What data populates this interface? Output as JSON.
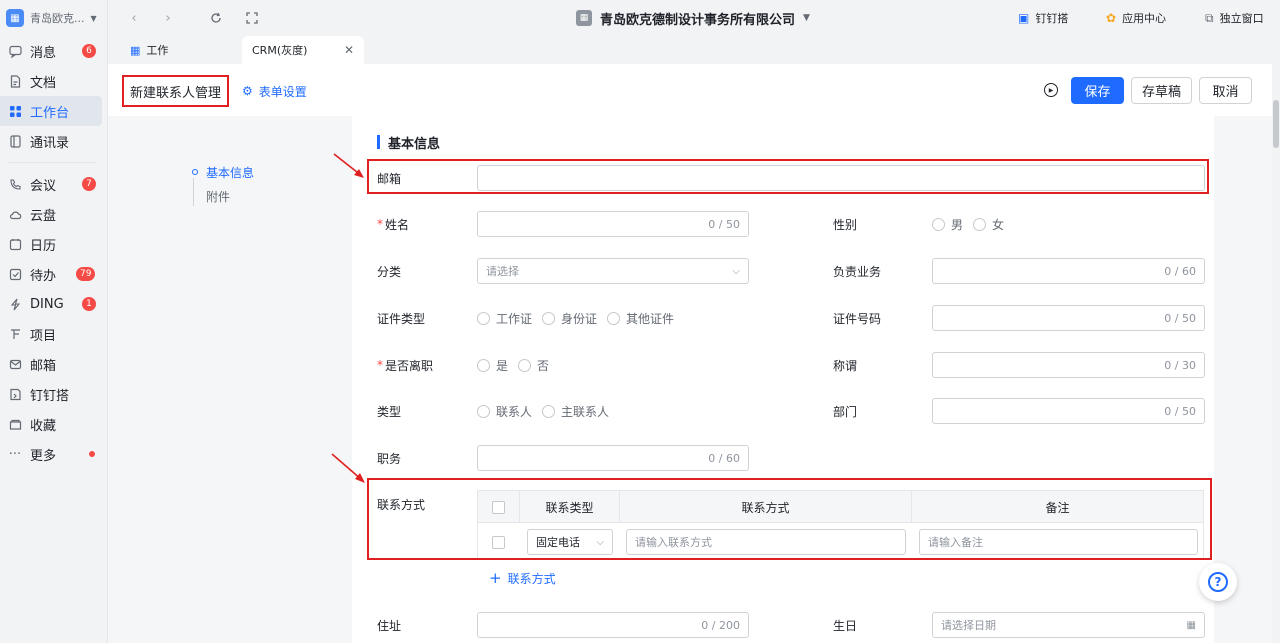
{
  "org": {
    "name": "青岛欧克...",
    "logo": "org-icon"
  },
  "sidebar": {
    "items": [
      {
        "label": "消息",
        "icon": "message-icon",
        "badge": "6"
      },
      {
        "label": "文档",
        "icon": "document-icon"
      },
      {
        "label": "工作台",
        "icon": "workbench-icon",
        "active": true
      },
      {
        "label": "通讯录",
        "icon": "contacts-icon"
      },
      {
        "label": "会议",
        "icon": "meeting-icon",
        "badge": "7"
      },
      {
        "label": "云盘",
        "icon": "cloud-icon"
      },
      {
        "label": "日历",
        "icon": "calendar-icon"
      },
      {
        "label": "待办",
        "icon": "todo-icon",
        "badge": "79"
      },
      {
        "label": "DING",
        "icon": "ding-icon",
        "badge": "1"
      },
      {
        "label": "项目",
        "icon": "project-icon"
      },
      {
        "label": "邮箱",
        "icon": "mail-icon"
      },
      {
        "label": "钉钉搭",
        "icon": "dingda-icon"
      },
      {
        "label": "收藏",
        "icon": "favorite-icon"
      },
      {
        "label": "更多",
        "icon": "more-icon"
      }
    ]
  },
  "topbar": {
    "title": "青岛欧克德制设计事务所有限公司",
    "links": [
      {
        "label": "钉钉搭",
        "icon": "dingda-icon"
      },
      {
        "label": "应用中心",
        "icon": "app-center-icon"
      },
      {
        "label": "独立窗口",
        "icon": "window-icon"
      }
    ]
  },
  "tabs": [
    {
      "label": "工作",
      "icon": "workbench-icon"
    },
    {
      "label": "CRM(灰度)",
      "active": true
    }
  ],
  "header": {
    "title": "新建联系人管理",
    "form_settings": "表单设置",
    "save": "保存",
    "draft": "存草稿",
    "cancel": "取消"
  },
  "anchor": {
    "basic": "基本信息",
    "attachment": "附件"
  },
  "form": {
    "section_title": "基本信息",
    "email_label": "邮箱",
    "name_label": "姓名",
    "name_count": "0 / 50",
    "gender_label": "性别",
    "gender_options": [
      "男",
      "女"
    ],
    "category_label": "分类",
    "category_placeholder": "请选择",
    "business_label": "负责业务",
    "business_count": "0 / 60",
    "id_type_label": "证件类型",
    "id_type_options": [
      "工作证",
      "身份证",
      "其他证件"
    ],
    "id_no_label": "证件号码",
    "id_no_count": "0 / 50",
    "resigned_label": "是否离职",
    "resigned_options": [
      "是",
      "否"
    ],
    "title_label": "称谓",
    "title_count": "0 / 30",
    "type_label": "类型",
    "type_options": [
      "联系人",
      "主联系人"
    ],
    "dept_label": "部门",
    "dept_count": "0 / 50",
    "position_label": "职务",
    "position_count": "0 / 60",
    "contact_label": "联系方式",
    "contact_table": {
      "headers": [
        "联系类型",
        "联系方式",
        "备注"
      ],
      "row": {
        "type": "固定电话",
        "contact_placeholder": "请输入联系方式",
        "remark_placeholder": "请输入备注"
      }
    },
    "add_contact": "联系方式",
    "address_label": "住址",
    "address_count": "0 / 200",
    "birthday_label": "生日",
    "birthday_placeholder": "请选择日期"
  },
  "colors": {
    "accent": "#1f6bff",
    "annotation": "#e02020",
    "badge": "#f54a45"
  }
}
